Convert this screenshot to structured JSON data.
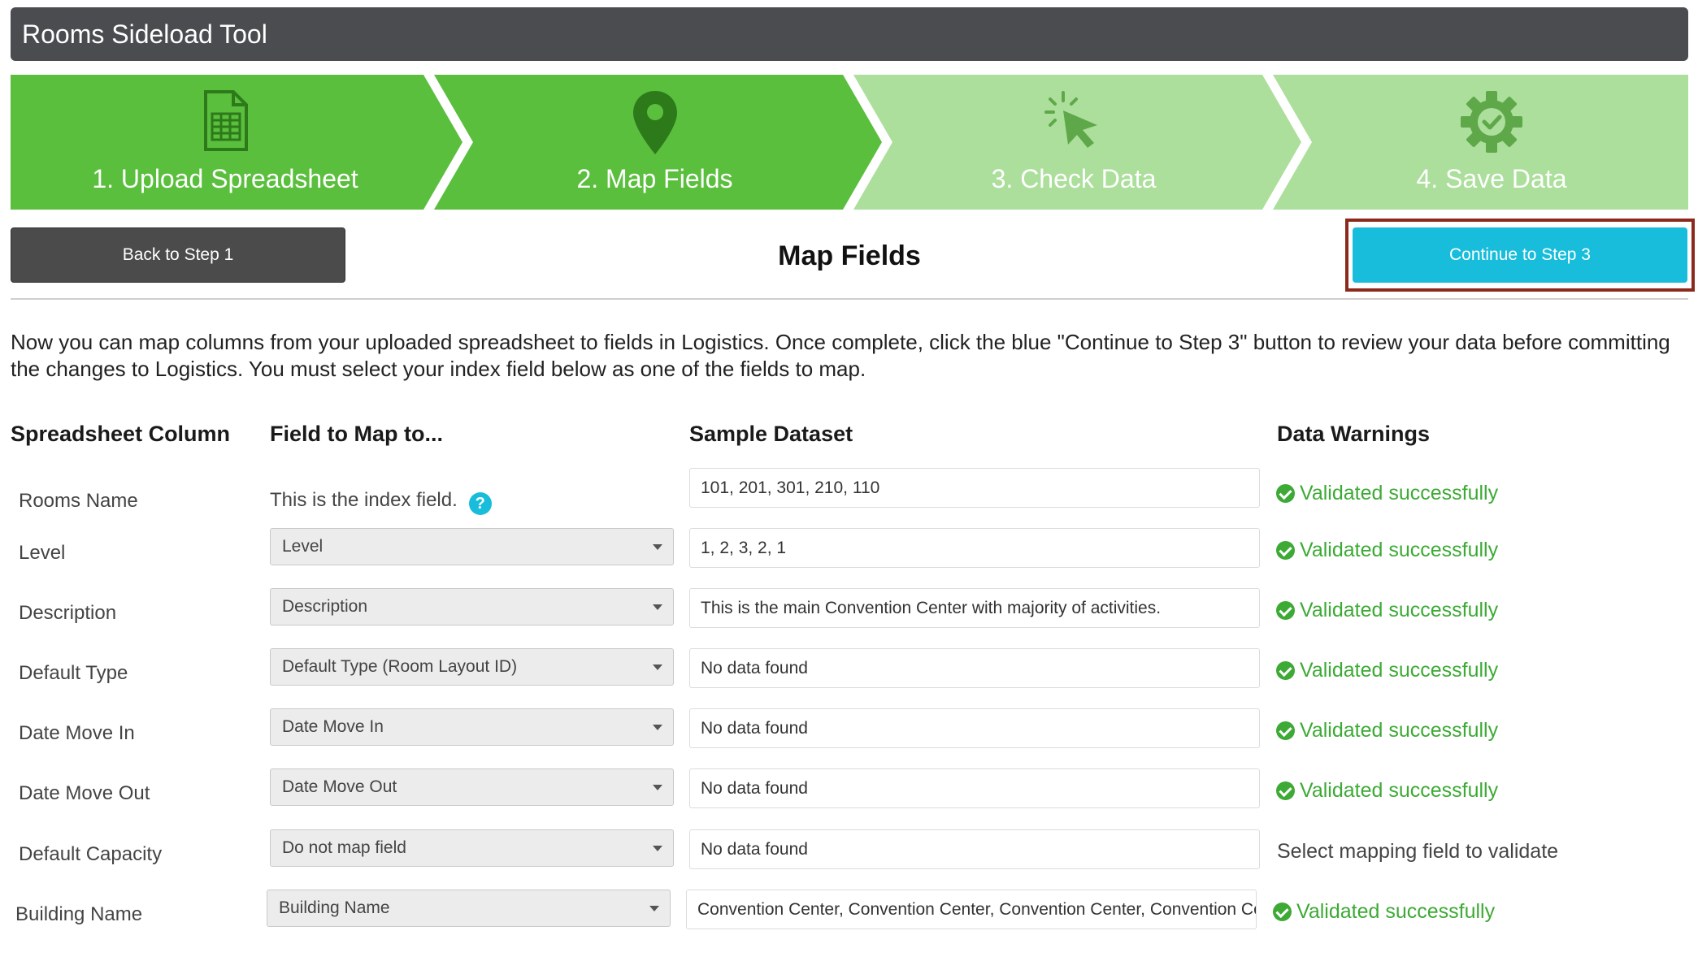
{
  "app": {
    "title": "Rooms Sideload Tool"
  },
  "steps": [
    {
      "label": "1. Upload Spreadsheet",
      "icon": "spreadsheet-icon",
      "state": "complete"
    },
    {
      "label": "2. Map Fields",
      "icon": "map-pin-icon",
      "state": "active"
    },
    {
      "label": "3. Check Data",
      "icon": "cursor-click-icon",
      "state": "pending"
    },
    {
      "label": "4. Save Data",
      "icon": "gear-check-icon",
      "state": "pending"
    }
  ],
  "colors": {
    "step_active": "#5bbf3e",
    "step_pending": "#acdf9b",
    "step_icon_dark": "#2d7a1a",
    "continue_button": "#17bddb",
    "success": "#3daa35"
  },
  "toolbar": {
    "back_label": "Back to Step 1",
    "title": "Map Fields",
    "continue_label": "Continue to Step 3"
  },
  "intro": "Now you can map columns from your uploaded spreadsheet to fields in Logistics. Once complete, click the blue \"Continue to Step 3\" button to review your data before committing the changes to Logistics. You must select your index field below as one of the fields to map.",
  "table": {
    "headers": {
      "column": "Spreadsheet Column",
      "field": "Field to Map to...",
      "sample": "Sample Dataset",
      "warnings": "Data Warnings"
    },
    "index_note": "This is the index field.",
    "help_glyph": "?",
    "rows": [
      {
        "column": "Rooms Name",
        "field": "",
        "sample": "101, 201, 301, 210, 110",
        "warning": "Validated successfully"
      },
      {
        "column": "Level",
        "field": "Level",
        "sample": "1, 2, 3, 2, 1",
        "warning": "Validated successfully"
      },
      {
        "column": "Description",
        "field": "Description",
        "sample": "This is the main Convention Center with majority of activities.",
        "warning": "Validated successfully"
      },
      {
        "column": "Default Type",
        "field": "Default Type (Room Layout ID)",
        "sample": "No data found",
        "warning": "Validated successfully"
      },
      {
        "column": "Date Move In",
        "field": "Date Move In",
        "sample": "No data found",
        "warning": "Validated successfully"
      },
      {
        "column": "Date Move Out",
        "field": "Date Move Out",
        "sample": "No data found",
        "warning": "Validated successfully"
      },
      {
        "column": "Default Capacity",
        "field": "Do not map field",
        "sample": "No data found",
        "warning": "Select mapping field to validate"
      },
      {
        "column": "Building Name",
        "field": "Building Name",
        "sample": "Convention Center, Convention Center, Convention Center, Convention Center",
        "warning": "Validated successfully"
      }
    ]
  }
}
